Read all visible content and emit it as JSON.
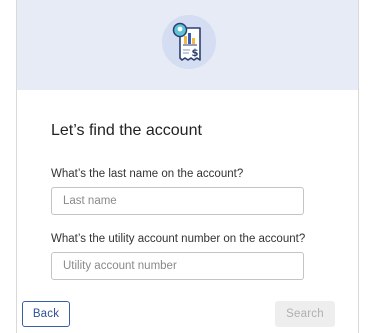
{
  "banner": {
    "icon": "bill-chart-dollar-icon",
    "bg_color": "#e6ebf6"
  },
  "form": {
    "title": "Let’s find the account",
    "last_name_label": "What’s the last name on the account?",
    "last_name_placeholder": "Last name",
    "last_name_value": "",
    "account_label": "What’s the utility account number on the account?",
    "account_placeholder": "Utility account number",
    "account_value": ""
  },
  "actions": {
    "back_label": "Back",
    "search_label": "Search",
    "search_disabled": true,
    "accent_color": "#2f4f97"
  }
}
